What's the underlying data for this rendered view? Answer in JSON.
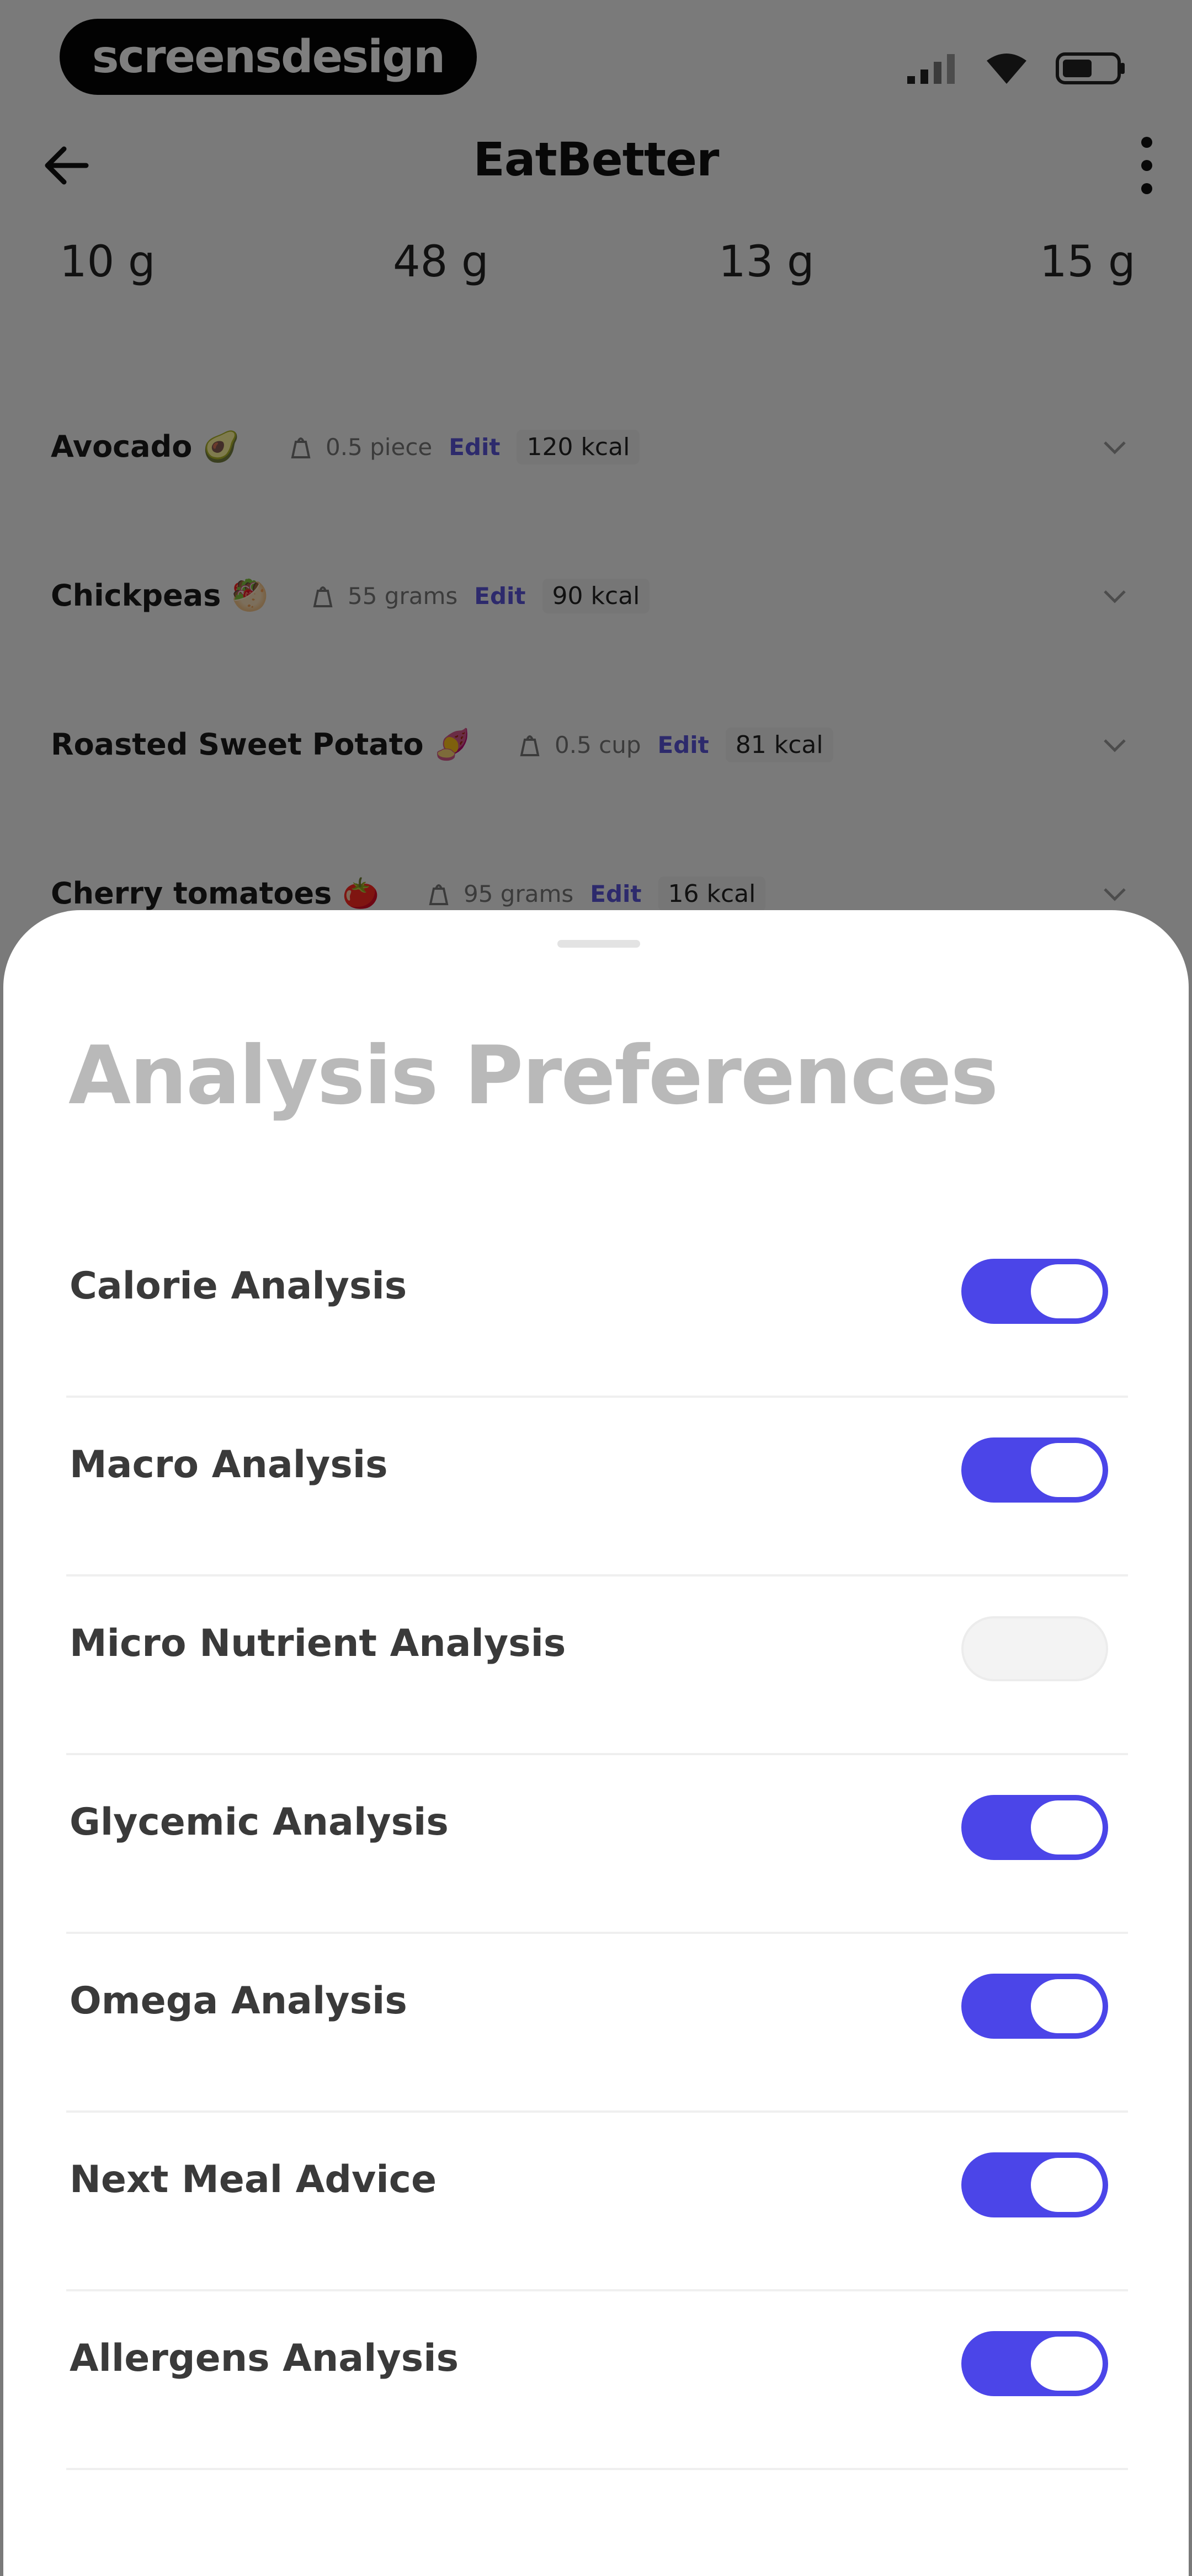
{
  "status_bar": {
    "brand": "screensdesign",
    "icons": [
      "signal-icon",
      "wifi-icon",
      "battery-icon"
    ]
  },
  "app_bar": {
    "title": "EatBetter",
    "back_icon": "arrow-left-icon",
    "menu_icon": "more-vertical-icon"
  },
  "macros": [
    "10 g",
    "48 g",
    "13 g",
    "15 g"
  ],
  "food_items": [
    {
      "name": "Avocado 🥑",
      "quantity": "0.5 piece",
      "edit": "Edit",
      "kcal": "120 kcal"
    },
    {
      "name": "Chickpeas 🥙",
      "quantity": "55 grams",
      "edit": "Edit",
      "kcal": "90 kcal"
    },
    {
      "name": "Roasted Sweet Potato 🍠",
      "quantity": "0.5 cup",
      "edit": "Edit",
      "kcal": "81 kcal"
    },
    {
      "name": "Cherry tomatoes 🍅",
      "quantity": "95 grams",
      "edit": "Edit",
      "kcal": "16 kcal"
    }
  ],
  "sheet": {
    "title": "Analysis Preferences",
    "preferences": [
      {
        "label": "Calorie Analysis",
        "enabled": true
      },
      {
        "label": "Macro Analysis",
        "enabled": true
      },
      {
        "label": "Micro Nutrient Analysis",
        "enabled": false
      },
      {
        "label": "Glycemic Analysis",
        "enabled": true
      },
      {
        "label": "Omega Analysis",
        "enabled": true
      },
      {
        "label": "Next Meal Advice",
        "enabled": true
      },
      {
        "label": "Allergens Analysis",
        "enabled": true
      }
    ]
  },
  "colors": {
    "accent": "#4b45e8",
    "toggle_off": "#f3f3f3",
    "sheet_title": "#b9b9b9",
    "edit_link": "#5a55d8"
  }
}
